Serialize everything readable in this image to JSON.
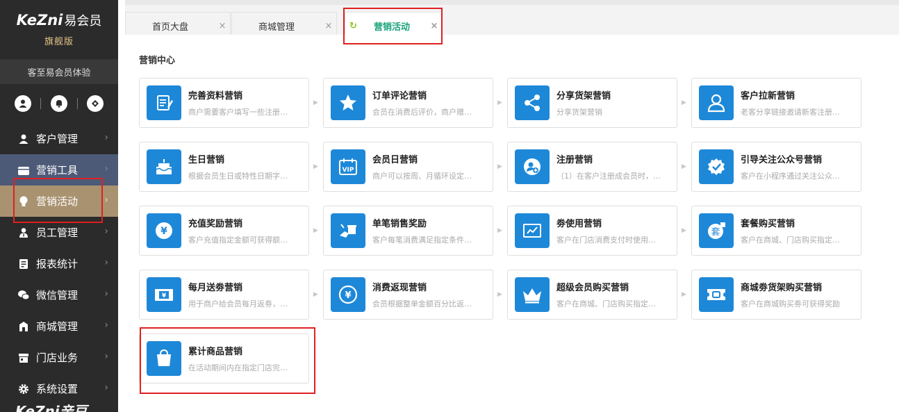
{
  "brand": {
    "logo_latin": "KeZni",
    "logo_cn": "易会员",
    "edition": "旗舰版",
    "bottom_logo": "KeZni亲豆"
  },
  "account": {
    "name": "客至易会员体验"
  },
  "quick_icons": [
    "user-icon",
    "bell-icon",
    "notification-icon"
  ],
  "nav": [
    {
      "label": "客户管理",
      "icon": "user-icon"
    },
    {
      "label": "营销工具",
      "icon": "briefcase-icon"
    },
    {
      "label": "营销活动",
      "icon": "lightbulb-icon"
    },
    {
      "label": "员工管理",
      "icon": "staff-icon"
    },
    {
      "label": "报表统计",
      "icon": "report-icon"
    },
    {
      "label": "微信管理",
      "icon": "wechat-icon"
    },
    {
      "label": "商城管理",
      "icon": "shop-icon"
    },
    {
      "label": "门店业务",
      "icon": "store-icon"
    },
    {
      "label": "系统设置",
      "icon": "gear-icon"
    }
  ],
  "tabs": [
    {
      "label": "首页大盘",
      "close": "×"
    },
    {
      "label": "商城管理",
      "close": "×"
    },
    {
      "label": "营销活动",
      "close": "×"
    }
  ],
  "section_title": "营销中心",
  "cards": [
    {
      "title": "完善资料营销",
      "desc": "商户需要客户填写一些注册…",
      "icon": "form-icon"
    },
    {
      "title": "订单评论营销",
      "desc": "会员在消费后评价，商户赠…",
      "icon": "star-icon"
    },
    {
      "title": "分享货架营销",
      "desc": "分享货架营销",
      "icon": "share-icon"
    },
    {
      "title": "客户拉新营销",
      "desc": "老客分享链接邀请新客注册…",
      "icon": "referral-icon"
    },
    {
      "title": "生日营销",
      "desc": "根据会员生日或特性日期字…",
      "icon": "cake-icon"
    },
    {
      "title": "会员日营销",
      "desc": "商户可以按周、月循环设定…",
      "icon": "vip-calendar-icon"
    },
    {
      "title": "注册营销",
      "desc": "（1）在客户注册成会员时，…",
      "icon": "register-icon"
    },
    {
      "title": "引导关注公众号营销",
      "desc": "客户在小程序通过关注公众…",
      "icon": "follow-icon"
    },
    {
      "title": "充值奖励营销",
      "desc": "客户充值指定金额可获得额…",
      "icon": "yuan-icon"
    },
    {
      "title": "单笔销售奖励",
      "desc": "客户每笔消费满足指定条件…",
      "icon": "gift-hand-icon"
    },
    {
      "title": "劵使用营销",
      "desc": "客户在门店消费支付时使用…",
      "icon": "voucher-icon"
    },
    {
      "title": "套餐购买营销",
      "desc": "客户在商城、门店购买指定…",
      "icon": "package-icon"
    },
    {
      "title": "每月送劵营销",
      "desc": "用于商户给会员每月返劵，…",
      "icon": "monthly-coupon-icon"
    },
    {
      "title": "消费返现营销",
      "desc": "会员根据整单金额百分比返…",
      "icon": "cashback-icon"
    },
    {
      "title": "超级会员购买营销",
      "desc": "客户在商城、门店购买指定…",
      "icon": "crown-icon"
    },
    {
      "title": "商城劵货架购买营销",
      "desc": "客户在商城购买劵可获得奖励",
      "icon": "ticket-icon"
    },
    {
      "title": "累计商品营销",
      "desc": "在活动期间内在指定门店完…",
      "icon": "shopping-bag-icon"
    }
  ],
  "arrow_glyph": "▶",
  "colors": {
    "accent_blue": "#1e88d8",
    "active_tab": "#1aa37a",
    "sidebar_active": "#a99270",
    "highlight": "#e02020"
  }
}
